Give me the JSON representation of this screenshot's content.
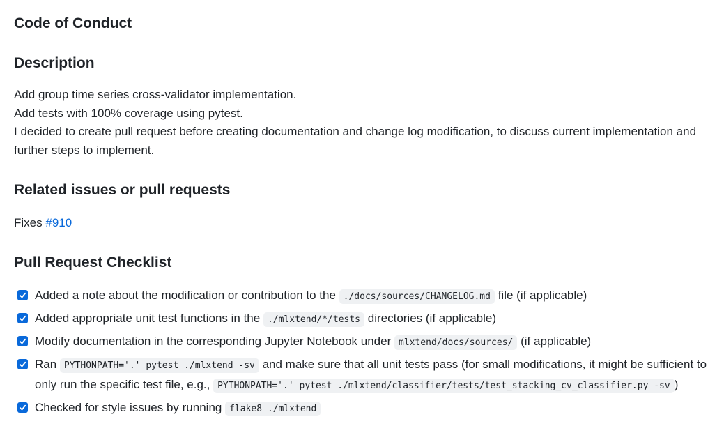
{
  "headings": {
    "code_of_conduct": "Code of Conduct",
    "description": "Description",
    "related": "Related issues or pull requests",
    "checklist": "Pull Request Checklist"
  },
  "description": {
    "line1": "Add group time series cross-validator implementation.",
    "line2": "Add tests with 100% coverage using pytest.",
    "line3": "I decided to create pull request before creating documentation and change log modification, to discuss current implementation and further steps to implement."
  },
  "fixes": {
    "prefix": "Fixes",
    "link": "#910"
  },
  "checklist": {
    "item1": {
      "before": "Added a note about the modification or contribution to the",
      "code": "./docs/sources/CHANGELOG.md",
      "after": "file (if applicable)",
      "checked": true
    },
    "item2": {
      "before": "Added appropriate unit test functions in the",
      "code": "./mlxtend/*/tests",
      "after": "directories (if applicable)",
      "checked": true
    },
    "item3": {
      "before": "Modify documentation in the corresponding Jupyter Notebook under",
      "code": "mlxtend/docs/sources/",
      "after": "(if applicable)",
      "checked": true
    },
    "item4": {
      "before": "Ran",
      "code1": "PYTHONPATH='.' pytest ./mlxtend -sv",
      "middle": "and make sure that all unit tests pass (for small modifications, it might be sufficient to only run the specific test file, e.g.,",
      "code2": "PYTHONPATH='.' pytest ./mlxtend/classifier/tests/test_stacking_cv_classifier.py -sv",
      "after": ")",
      "checked": true
    },
    "item5": {
      "before": "Checked for style issues by running",
      "code": "flake8 ./mlxtend",
      "checked": true
    }
  },
  "colors": {
    "link": "#0969da",
    "checkbox": "#0969da",
    "text": "#1f2328",
    "code_bg": "#eff1f3"
  }
}
